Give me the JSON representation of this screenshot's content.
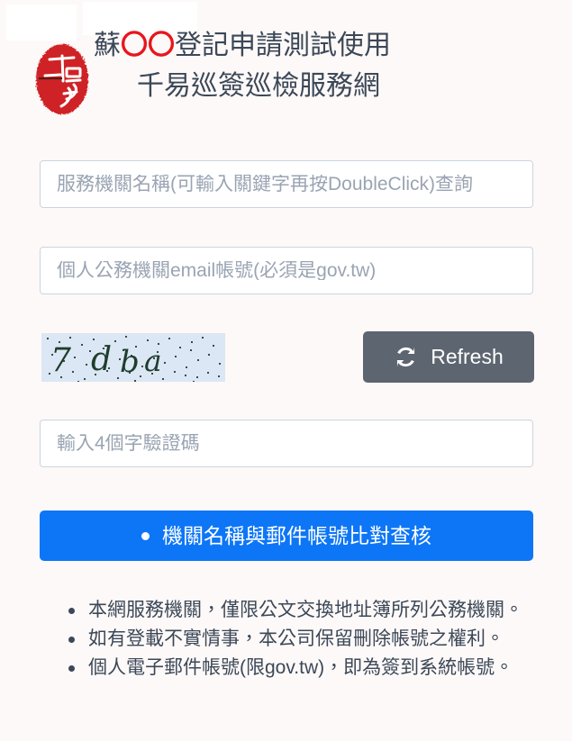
{
  "page": {
    "background_color": "#fdf9f8",
    "text_color": "#3c4858"
  },
  "broken_images": [
    {
      "name": "broken-image-left",
      "alt": ""
    },
    {
      "name": "broken-image-right",
      "alt": ""
    }
  ],
  "header": {
    "seal_icon": "red-oval-seal-stamp",
    "seal_color": "#cf2127",
    "seal_text": "千易",
    "title_line_1_prefix": "蘇",
    "title_line_1_circles": "〇〇",
    "title_line_1_suffix": "登記申請測試使用",
    "title_line_2": "千易巡簽巡檢服務網",
    "circle_color": "#e8151d"
  },
  "form": {
    "org_field": {
      "label": "服務機關名稱",
      "placeholder": "服務機關名稱(可輸入關鍵字再按DoubleClick)查詢",
      "value": ""
    },
    "email_field": {
      "label": "個人公務機關email帳號",
      "placeholder": "個人公務機關email帳號(必須是gov.tw)",
      "value": ""
    },
    "captcha": {
      "image_text": "7dba",
      "image_background": "#dbe7f4",
      "image_text_color": "#2c4a3a",
      "refresh_label": "Refresh",
      "refresh_icon": "refresh-sync-icon",
      "refresh_background": "#5c6570"
    },
    "captcha_field": {
      "label": "驗證碼",
      "placeholder": "輸入4個字驗證碼",
      "value": ""
    },
    "submit": {
      "label": "機關名稱與郵件帳號比對查核",
      "bullet_icon": "bullet-dot-icon",
      "background": "#0d76f7"
    }
  },
  "notes": {
    "items": [
      "本網服務機關，僅限公文交換地址簿所列公務機關。",
      "如有登載不實情事，本公司保留刪除帳號之權利。",
      "個人電子郵件帳號(限gov.tw)，即為簽到系統帳號。"
    ]
  }
}
